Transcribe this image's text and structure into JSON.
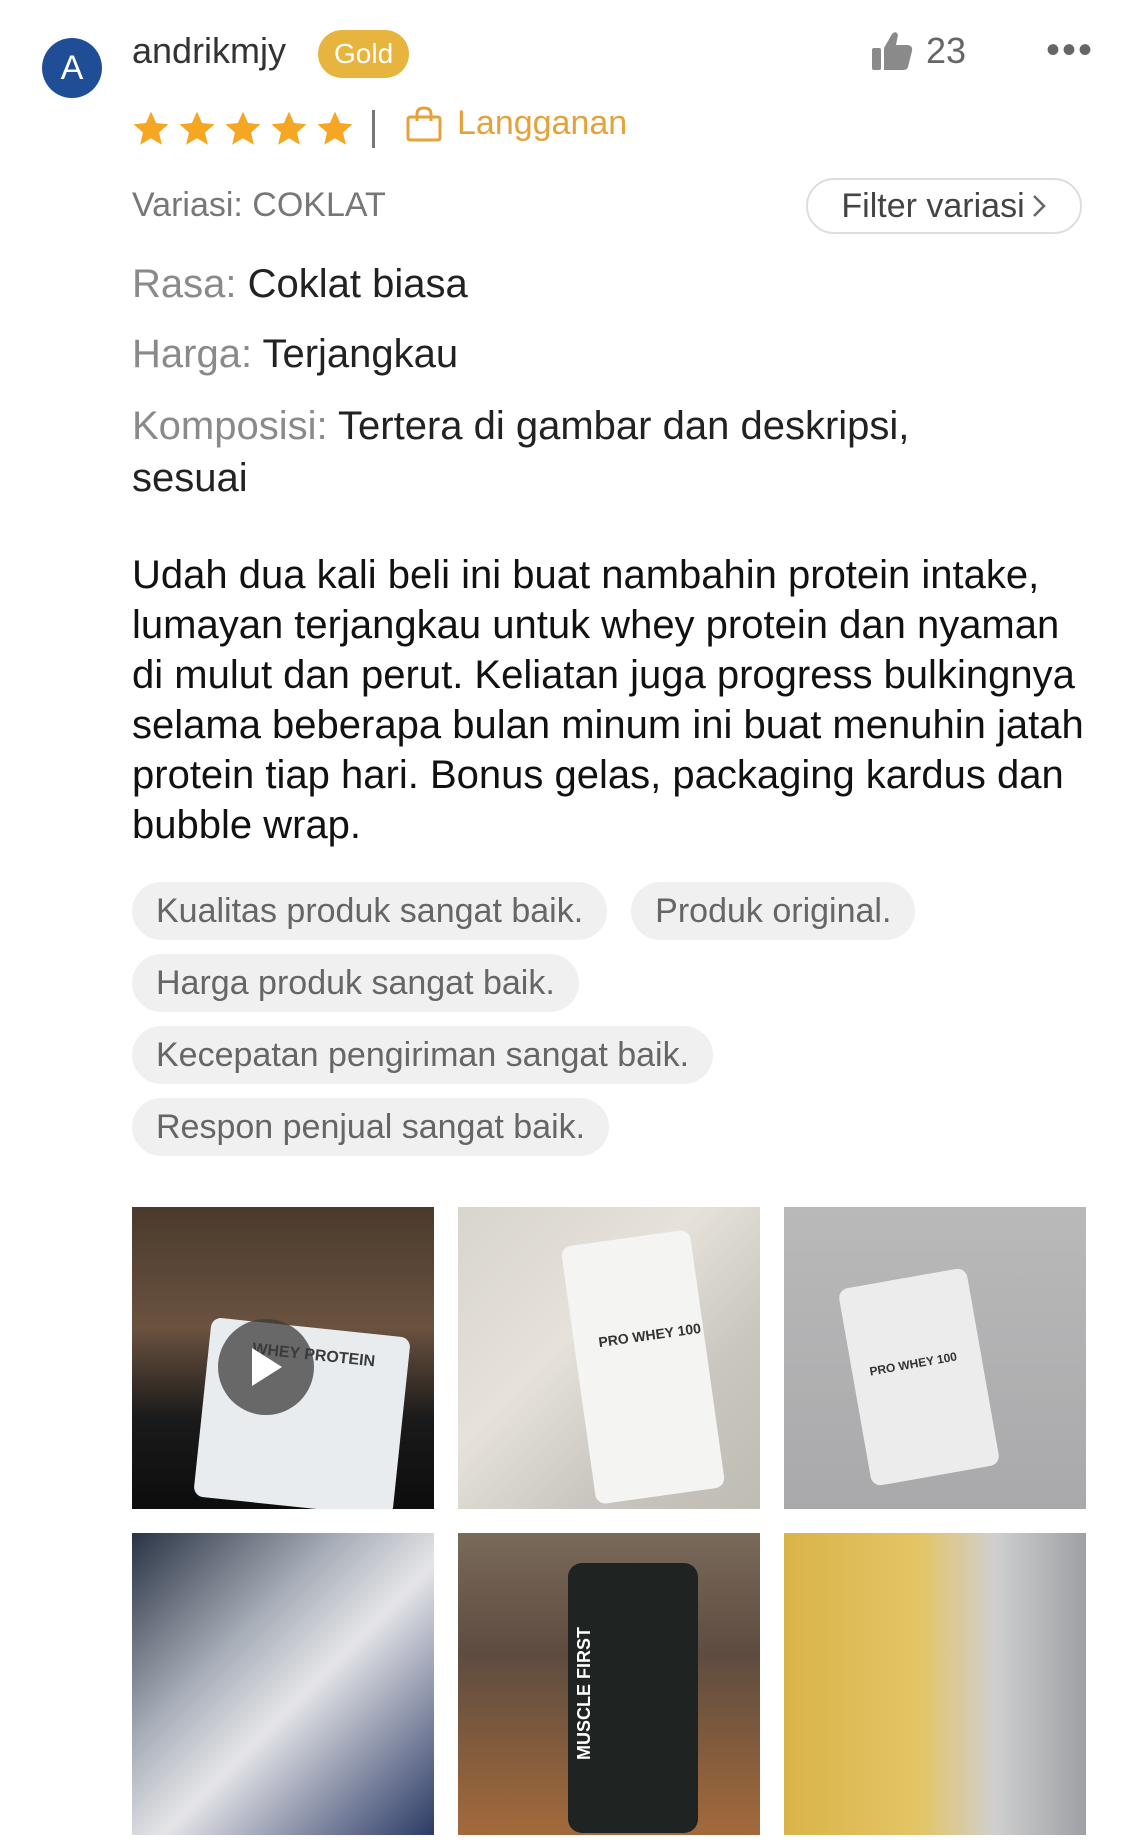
{
  "user": {
    "initial": "A",
    "name": "andrikmjy",
    "badge": "Gold"
  },
  "likes": {
    "count": "23"
  },
  "more_label": "•••",
  "rating": {
    "stars": 5,
    "max": 5
  },
  "subscription_label": "Langganan",
  "variation": "Variasi: COKLAT",
  "filter_label": "Filter variasi",
  "attributes": {
    "rasa_key": "Rasa:",
    "rasa_val": "Coklat biasa",
    "harga_key": "Harga:",
    "harga_val": "Terjangkau",
    "komposisi_key": "Komposisi:",
    "komposisi_val": "Tertera di gambar dan deskripsi, sesuai"
  },
  "review_text": "Udah dua kali beli ini buat nambahin protein intake, lumayan terjangkau untuk whey protein dan nyaman di mulut dan perut. Keliatan juga progress bulkingnya selama beberapa bulan minum ini buat menuhin jatah protein tiap hari. Bonus gelas, packaging kardus dan bubble wrap.",
  "tags": [
    "Kualitas produk sangat baik.",
    "Produk original.",
    "Harga produk sangat baik.",
    "Kecepatan pengiriman sangat baik.",
    "Respon penjual sangat baik."
  ],
  "photos": {
    "photo1_text": "WHEY PROTEIN",
    "photo2_text": "PRO WHEY 100",
    "photo3_text": "PRO WHEY 100",
    "photo5_text": "MUSCLE FIRST"
  },
  "colors": {
    "accent": "#e6a23a",
    "badge": "#e7b43d",
    "avatar": "#1f4e96"
  }
}
